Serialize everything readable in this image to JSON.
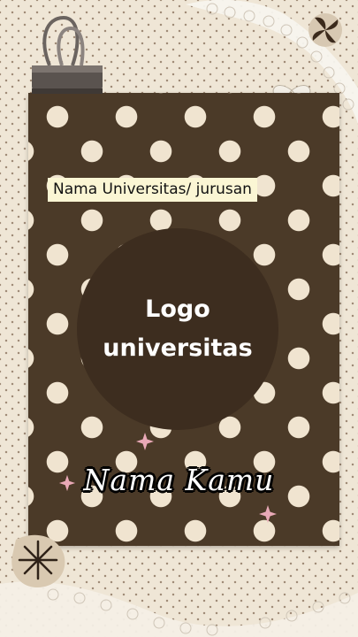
{
  "header": {
    "university_label": "Nama Universitas/ jurusan"
  },
  "logo": {
    "line1": "Logo",
    "line2": "universitas"
  },
  "name": {
    "text": "Nama Kamu"
  },
  "colors": {
    "background": "#efe6d6",
    "card_brown": "#4b3a28",
    "dot_cream": "#f0e4d0",
    "circle": "#3d2d1f",
    "label_bg": "#fbf6d4",
    "star_pink": "#e9a9b7"
  },
  "decorations": [
    "binder-clip-icon",
    "lace-ribbon",
    "star-icon",
    "dark-heart-flower-icon",
    "sun-stamp-icon",
    "bow-icon"
  ]
}
